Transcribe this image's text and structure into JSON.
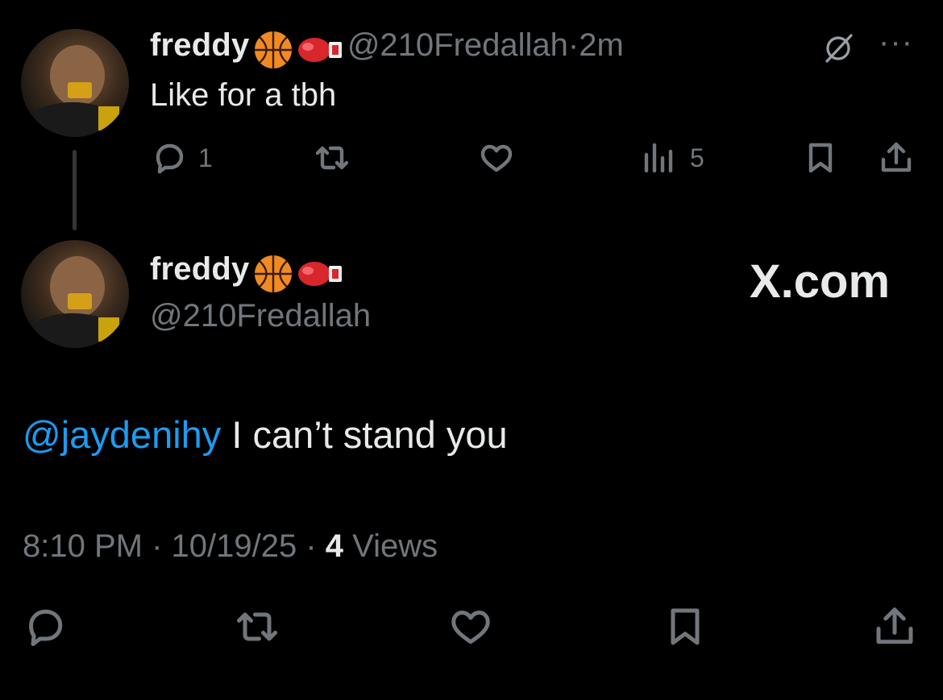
{
  "reply_tweet": {
    "display_name": "freddy",
    "badges": [
      "basketball-emoji",
      "boxing-glove-emoji"
    ],
    "handle": "@210Fredallah",
    "separator": "·",
    "age": "2m",
    "text": "Like for a tbh",
    "counts": {
      "replies": "1",
      "views": "5"
    },
    "menu_label": "···"
  },
  "main_tweet": {
    "display_name": "freddy",
    "badges": [
      "basketball-emoji",
      "boxing-glove-emoji"
    ],
    "handle": "@210Fredallah",
    "brand": "X.com",
    "mention": "@jaydenihy",
    "text": " I can’t stand you",
    "time": "8:10 PM",
    "sep1": " · ",
    "date": "10/19/25",
    "sep2": " · ",
    "views_count": "4",
    "views_label": " Views"
  },
  "colors": {
    "background": "#000000",
    "text": "#e7e9ea",
    "muted": "#71767b",
    "accent": "#1d9bf0"
  }
}
